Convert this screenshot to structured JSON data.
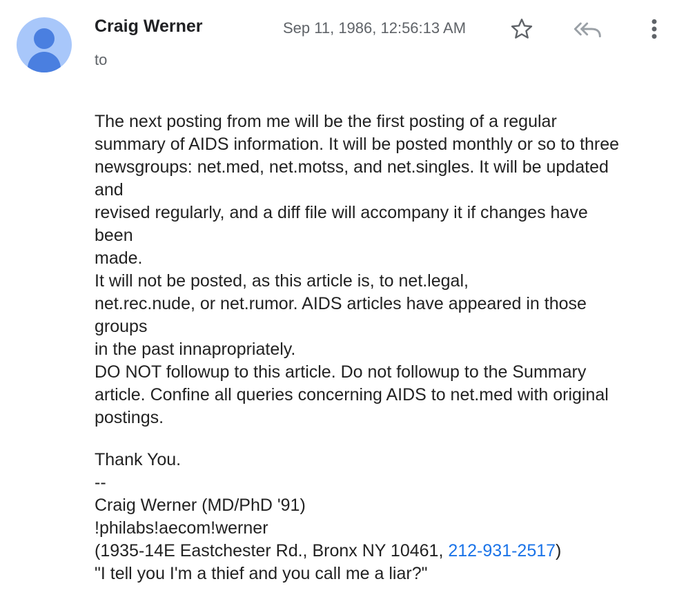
{
  "header": {
    "sender_name": "Craig Werner",
    "to_label": "to",
    "date": "Sep 11, 1986, 12:56:13 AM"
  },
  "icons": {
    "avatar": "person-avatar-icon",
    "star": "star-outline-icon",
    "reply_all": "reply-all-icon",
    "more": "more-vert-icon"
  },
  "colors": {
    "avatar_bg": "#a8c7fa",
    "avatar_fg": "#4a7fe0",
    "link": "#1a73e8",
    "meta": "#5f6368"
  },
  "message": {
    "paragraph1": "The next posting from me will be the first posting of a regular\nsummary of AIDS information. It will be posted monthly or so to three\nnewsgroups: net.med, net.motss, and net.singles. It will be updated\nand\nrevised regularly, and a diff file will accompany it if changes have\nbeen\nmade.\nIt will not be posted, as this article is, to net.legal,\nnet.rec.nude, or net.rumor. AIDS articles have appeared in those\ngroups\nin the past innapropriately.\nDO NOT followup to this article. Do not followup to the Summary\narticle. Confine all queries concerning AIDS to net.med with original\npostings.",
    "closing": "Thank You.",
    "sig_separator": "--",
    "sig_name": "Craig Werner (MD/PhD '91)",
    "sig_path": "!philabs!aecom!werner",
    "sig_address_prefix": "(1935-14E Eastchester Rd., Bronx NY 10461, ",
    "sig_phone": "212-931-2517",
    "sig_address_suffix": ")",
    "sig_quote": "\"I tell you I'm a thief and you call me a liar?\""
  }
}
